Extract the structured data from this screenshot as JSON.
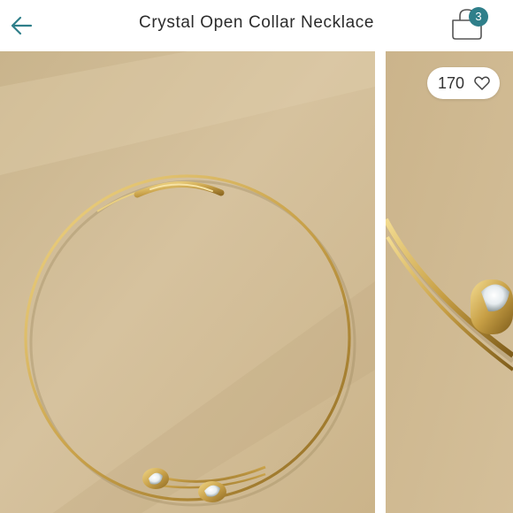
{
  "header": {
    "title": "Crystal Open Collar Necklace",
    "back_icon": "arrow-left-icon",
    "bag_icon": "shopping-bag-icon",
    "bag_count": "3"
  },
  "gallery": {
    "like_count": "170",
    "like_icon": "heart-outline-icon",
    "slides": [
      "Gold open collar necklace with two crystal tips",
      "Close-up of crystal tip"
    ]
  },
  "colors": {
    "accent": "#2f7f8a",
    "photo_background": "#cdb78f",
    "gold": "#c9a24a"
  }
}
